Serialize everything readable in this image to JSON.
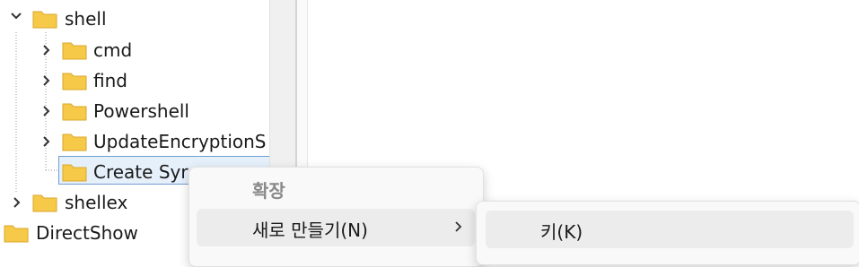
{
  "tree": {
    "shell": {
      "label": "shell",
      "expanded": true
    },
    "children": [
      {
        "label": "cmd"
      },
      {
        "label": "find"
      },
      {
        "label": "Powershell"
      },
      {
        "label": "UpdateEncryptionS"
      },
      {
        "label": "Create Syr"
      }
    ],
    "shellex": {
      "label": "shellex"
    },
    "directshow": {
      "label": "DirectShow"
    }
  },
  "context_menu": {
    "header": "확장",
    "new_item_label": "새로 만들기(N)"
  },
  "submenu": {
    "key_item_label": "키(K)"
  },
  "colors": {
    "folder_yellow": "#f7c948",
    "selection_border": "#6f9fd2",
    "selection_fill": "#e6f0fb"
  },
  "icons": {
    "expand": "chevron-down-icon",
    "collapsed": "chevron-right-icon",
    "folder": "folder-icon",
    "submenu_arrow": "chevron-right-icon"
  }
}
